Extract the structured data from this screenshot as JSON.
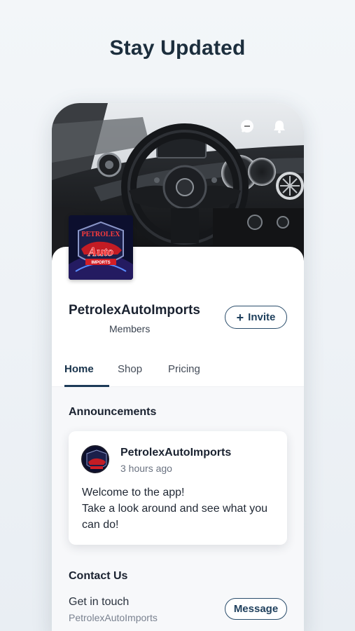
{
  "headline": "Stay Updated",
  "header": {
    "icons": [
      "chat-icon",
      "bell-icon"
    ]
  },
  "site": {
    "name": "PetrolexAutoImports",
    "members_label": "Members",
    "invite_label": "Invite",
    "logo_text_top": "PETROLEX",
    "logo_text_mid": "Auto",
    "logo_text_bottom": "IMPORTS"
  },
  "tabs": [
    {
      "label": "Home",
      "active": true
    },
    {
      "label": "Shop",
      "active": false
    },
    {
      "label": "Pricing",
      "active": false
    }
  ],
  "announcements": {
    "title": "Announcements",
    "post": {
      "author": "PetrolexAutoImports",
      "time": "3 hours ago",
      "line1": "Welcome to the app!",
      "line2": "Take a look around and see what you can do!"
    }
  },
  "contact": {
    "title": "Contact Us",
    "subtitle": "Get in touch",
    "name": "PetrolexAutoImports",
    "button_label": "Message"
  },
  "colors": {
    "accent": "#1e3f5c",
    "background": "#eef2f6"
  }
}
